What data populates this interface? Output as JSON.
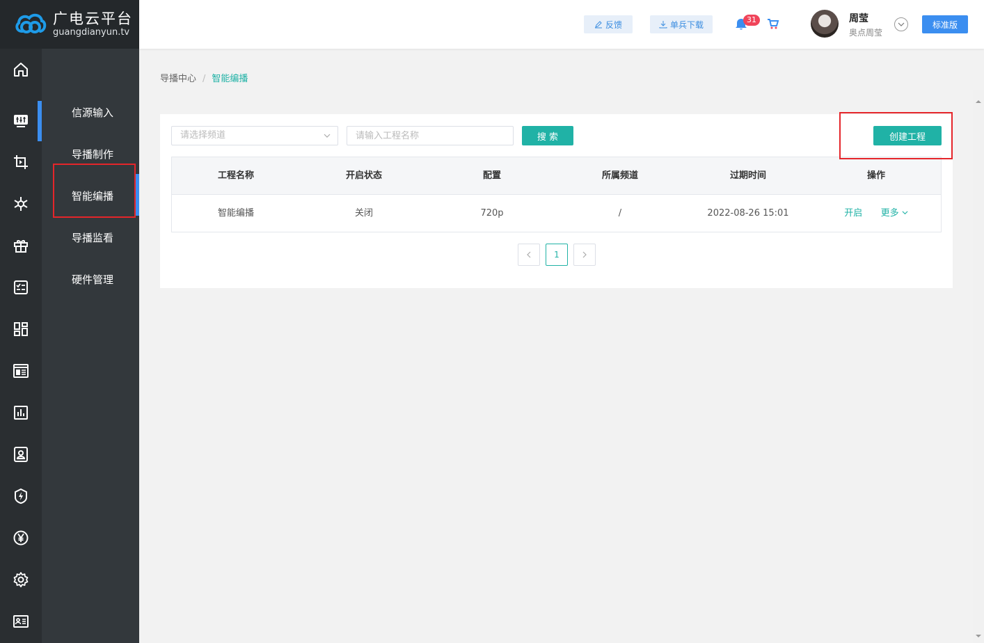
{
  "logo": {
    "title": "广电云平台",
    "subtitle": "guangdianyun.tv"
  },
  "header": {
    "feedback_label": "反馈",
    "download_label": "单兵下载",
    "notification_count": "31",
    "user_name": "周莹",
    "user_org": "奥点周莹",
    "edition_label": "标准版"
  },
  "rail": {
    "icons": [
      "home-icon",
      "director-icon",
      "media-icon",
      "network-icon",
      "gift-icon",
      "checklist-icon",
      "apps-icon",
      "news-icon",
      "chart-icon",
      "user-card-icon",
      "lightning-icon",
      "yen-icon",
      "settings-icon",
      "id-card-icon"
    ]
  },
  "submenu": {
    "items": [
      {
        "label": "信源输入"
      },
      {
        "label": "导播制作"
      },
      {
        "label": "智能编播"
      },
      {
        "label": "导播监看"
      },
      {
        "label": "硬件管理"
      }
    ]
  },
  "breadcrumb": {
    "root": "导播中心",
    "separator": "/",
    "current": "智能编播"
  },
  "filters": {
    "channel_placeholder": "请选择频道",
    "name_placeholder": "请输入工程名称",
    "search_label": "搜 索",
    "create_label": "创建工程"
  },
  "table": {
    "headers": [
      "工程名称",
      "开启状态",
      "配置",
      "所属频道",
      "过期时间",
      "操作"
    ],
    "rows": [
      {
        "name": "智能编播",
        "status": "关闭",
        "config": "720p",
        "channel": "/",
        "expire": "2022-08-26 15:01",
        "op_open": "开启",
        "op_more": "更多"
      }
    ]
  },
  "pagination": {
    "current": "1"
  },
  "colors": {
    "accent": "#20b2a6",
    "blue": "#3b8ef0",
    "highlight": "#e5252a",
    "sidebar": "#2a2e31"
  }
}
